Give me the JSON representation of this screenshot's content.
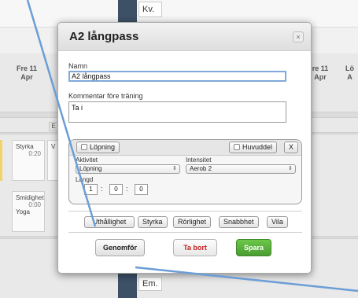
{
  "calendar": {
    "tab_top": "Kv.",
    "tab_bottom": "Em.",
    "day_left": {
      "day": "Fre 11",
      "month": "Apr"
    },
    "day_right": {
      "day": "re 11",
      "month": "Apr"
    },
    "day_far_right": {
      "day": "Lö",
      "month": "A"
    },
    "marker_e": "E",
    "cards": [
      {
        "title": "Styrka",
        "duration": "0:20",
        "subtitle": ""
      },
      {
        "title": "Smidighet",
        "duration": "0:00",
        "subtitle": "Yoga"
      }
    ],
    "partial_v": "V"
  },
  "dialog": {
    "title": "A2 långpass",
    "close_label": "×",
    "name_label": "Namn",
    "name_value": "A2 långpass",
    "comment_label": "Kommentar före träning",
    "comment_value": "Ta i",
    "activity_block": {
      "type_button": "Löpning",
      "main_part_label": "Huvuddel",
      "remove_label": "X",
      "activity_label": "Aktivitet",
      "activity_value": "Löpning",
      "intensity_label": "Intensitet",
      "intensity_value": "Aerob 2",
      "length_label": "Längd",
      "hours": "1",
      "minutes": "0",
      "seconds": "0",
      "colon": ":"
    },
    "add_buttons": [
      "Uthållighet",
      "Styrka",
      "Rörlighet",
      "Snabbhet",
      "Vila"
    ],
    "actions": {
      "perform": "Genomför",
      "delete": "Ta bort",
      "save": "Spara"
    }
  },
  "colors": {
    "accent_blue": "#7fa9dc",
    "delete_red": "#c52222",
    "save_green": "#5bb33f",
    "arrow": "#6b9ed6"
  }
}
